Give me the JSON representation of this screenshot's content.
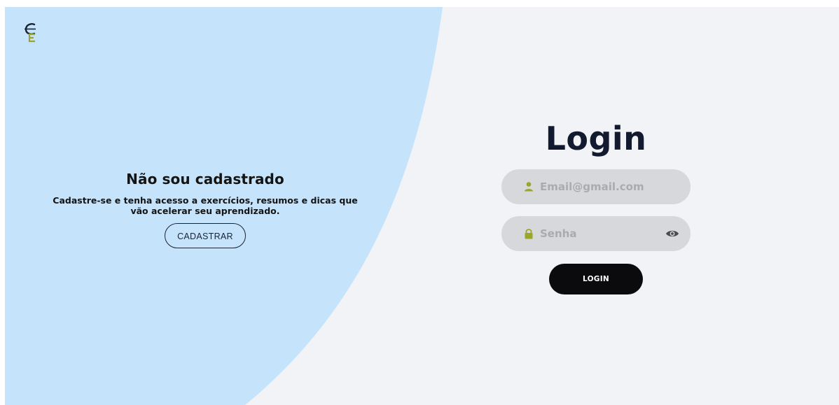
{
  "colors": {
    "page_bg": "#f2f3f7",
    "blob": "#c5e4fb",
    "navy": "#121a30",
    "field_bg": "#d6d8dc",
    "icon_green": "#9aa62a",
    "button_black": "#0b0b0d"
  },
  "logo": {
    "icon": "ce-logo-icon"
  },
  "signup": {
    "title": "Não sou cadastrado",
    "subtitle": "Cadastre-se e tenha acesso a exercícios, resumos e dicas que vão acelerar seu aprendizado.",
    "button_label": "CADASTRAR"
  },
  "login": {
    "title": "Login",
    "email": {
      "placeholder": "Email@gmail.com",
      "value": "",
      "icon": "user-icon"
    },
    "password": {
      "placeholder": "Senha",
      "value": "",
      "icon": "lock-icon",
      "toggle_icon": "eye-icon"
    },
    "button_label": "LOGIN"
  }
}
